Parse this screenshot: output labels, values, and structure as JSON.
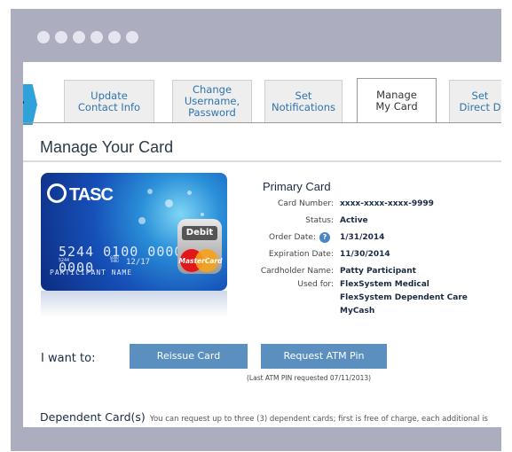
{
  "tabs": [
    {
      "label": "Update\nContact Info",
      "active": false
    },
    {
      "label": "Change\nUsername,\nPassword",
      "active": false
    },
    {
      "label": "Set\nNotifications",
      "active": false
    },
    {
      "label": "Manage\nMy Card",
      "active": true
    },
    {
      "label": "Set\nDirect D",
      "active": false
    }
  ],
  "page_title": "Manage Your Card",
  "card_image": {
    "logo": "TASC",
    "number": "5244 0100 0000 0000",
    "small_number": "5244",
    "exp": "12/17",
    "exp_prefix": "GOOD THRU",
    "name": "PARTICIPANT NAME",
    "debit": "Debit",
    "network": "MasterCard"
  },
  "primary_card": {
    "heading": "Primary Card",
    "card_number_label": "Card Number:",
    "card_number": "xxxx-xxxx-xxxx-9999",
    "status_label": "Status:",
    "status": "Active",
    "order_date_label": "Order Date:",
    "order_date": "1/31/2014",
    "expiration_label": "Expiration Date:",
    "expiration": "11/30/2014",
    "cardholder_label": "Cardholder Name:",
    "cardholder": "Patty Participant",
    "used_for_label": "Used for:",
    "used_for": [
      "FlexSystem Medical",
      "FlexSystem Dependent Care",
      "MyCash"
    ]
  },
  "actions": {
    "label": "I want to:",
    "reissue": "Reissue Card",
    "request_pin": "Request ATM Pin",
    "pin_note": "(Last ATM PIN requested 07/11/2013)"
  },
  "dependent": {
    "title": "Dependent Card(s)",
    "note": "You can request up to three (3) dependent cards; first is free of charge, each additional is"
  },
  "colors": {
    "frame": "#acaebf",
    "accent": "#2fa2da",
    "button": "#5b8fbf",
    "link": "#2e73ad"
  }
}
